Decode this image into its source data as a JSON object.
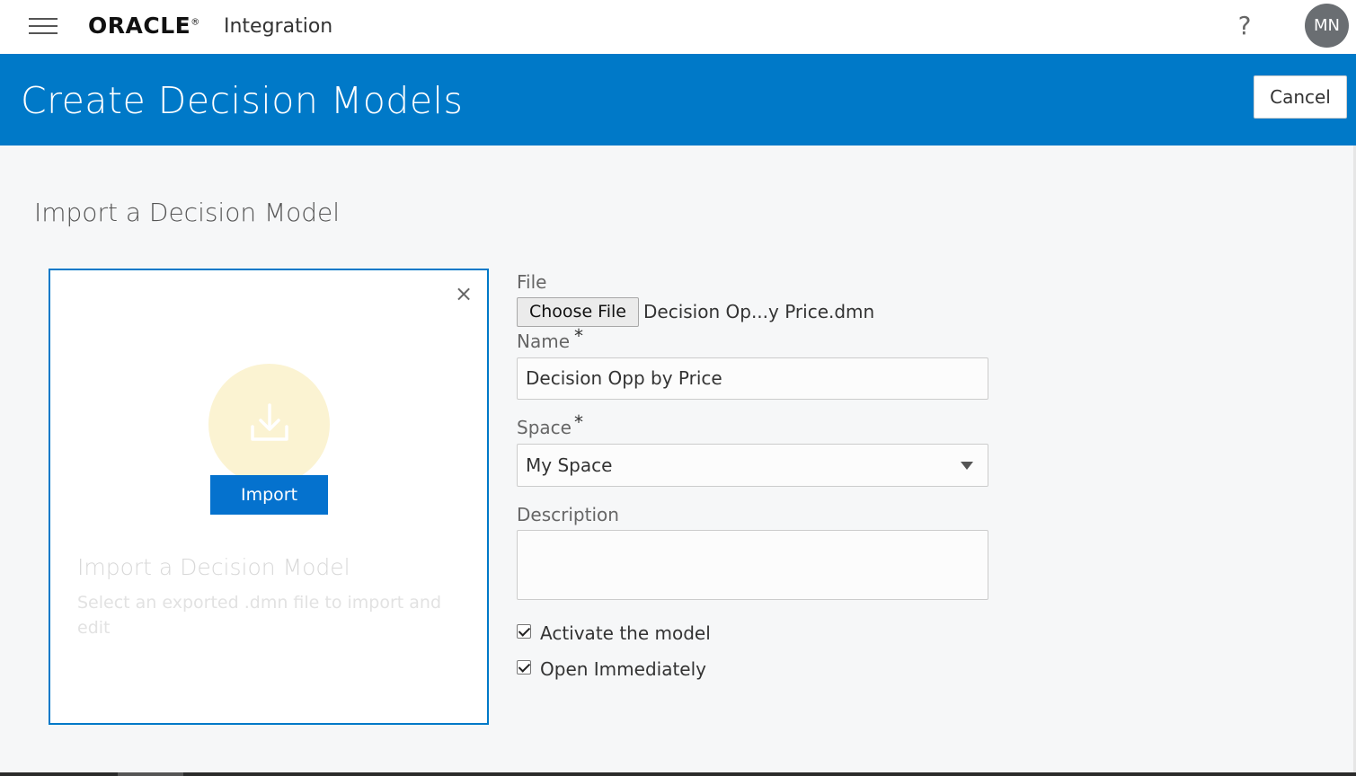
{
  "topbar": {
    "brand": "ORACLE",
    "brand_mark": "®",
    "product": "Integration",
    "help_symbol": "?",
    "avatar_initials": "MN"
  },
  "header": {
    "title": "Create Decision Models",
    "cancel_label": "Cancel",
    "background_color": "#0079c8"
  },
  "main": {
    "section_title": "Import a Decision Model"
  },
  "import_card": {
    "close_symbol": "×",
    "icon": "download-icon",
    "import_button_label": "Import",
    "heading": "Import a Decision Model",
    "description": "Select an exported .dmn file to import and edit"
  },
  "form": {
    "file_label": "File",
    "choose_file_label": "Choose File",
    "file_name": "Decision Op...y Price.dmn",
    "name_label": "Name",
    "name_value": "Decision Opp by Price",
    "required_marker": "*",
    "space_label": "Space",
    "space_value": "My Space",
    "description_label": "Description",
    "description_value": "",
    "activate_label": "Activate the model",
    "activate_checked": true,
    "open_label": "Open Immediately",
    "open_checked": true
  }
}
